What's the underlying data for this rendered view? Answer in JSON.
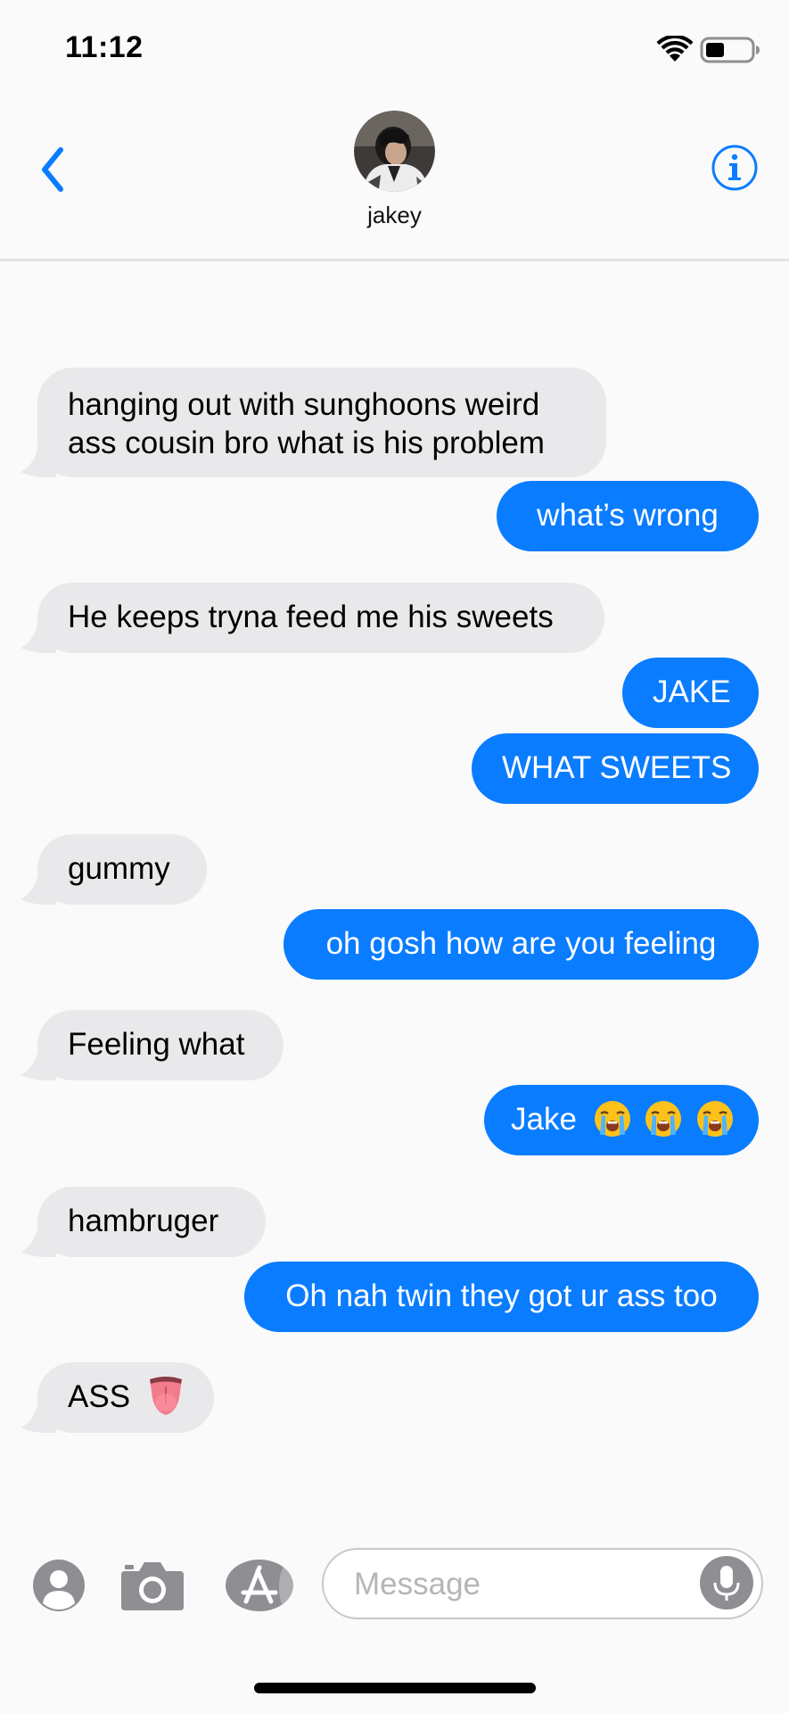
{
  "status_bar": {
    "time": "11:12"
  },
  "header": {
    "contact_name": "jakey",
    "back_icon": "chevron-left-icon",
    "info_icon": "info-circle-icon"
  },
  "colors": {
    "accent": "#0a7cff",
    "incoming_bubble": "#e9e9eb",
    "background": "#fafafb"
  },
  "messages": [
    {
      "direction": "incoming",
      "text": "hanging out with sunghoons weird ass cousin bro what is his problem"
    },
    {
      "direction": "outgoing",
      "text": "what’s wrong"
    },
    {
      "direction": "incoming",
      "text": "He keeps tryna feed me his sweets"
    },
    {
      "direction": "outgoing",
      "text": "JAKE"
    },
    {
      "direction": "outgoing",
      "text": "WHAT SWEETS"
    },
    {
      "direction": "incoming",
      "text": "gummy"
    },
    {
      "direction": "outgoing",
      "text": "oh gosh how are you feeling"
    },
    {
      "direction": "incoming",
      "text": "Feeling what"
    },
    {
      "direction": "outgoing",
      "text": "Jake",
      "emoji": [
        "loudly-crying-face",
        "loudly-crying-face",
        "loudly-crying-face"
      ]
    },
    {
      "direction": "incoming",
      "text": "hambruger"
    },
    {
      "direction": "outgoing",
      "text": "Oh nah twin they got ur ass too"
    },
    {
      "direction": "incoming",
      "text": "ASS",
      "emoji": [
        "face-with-tongue"
      ]
    }
  ],
  "input_bar": {
    "placeholder": "Message",
    "icons": [
      "contact-icon",
      "camera-icon",
      "app-store-icon",
      "microphone-icon"
    ]
  }
}
